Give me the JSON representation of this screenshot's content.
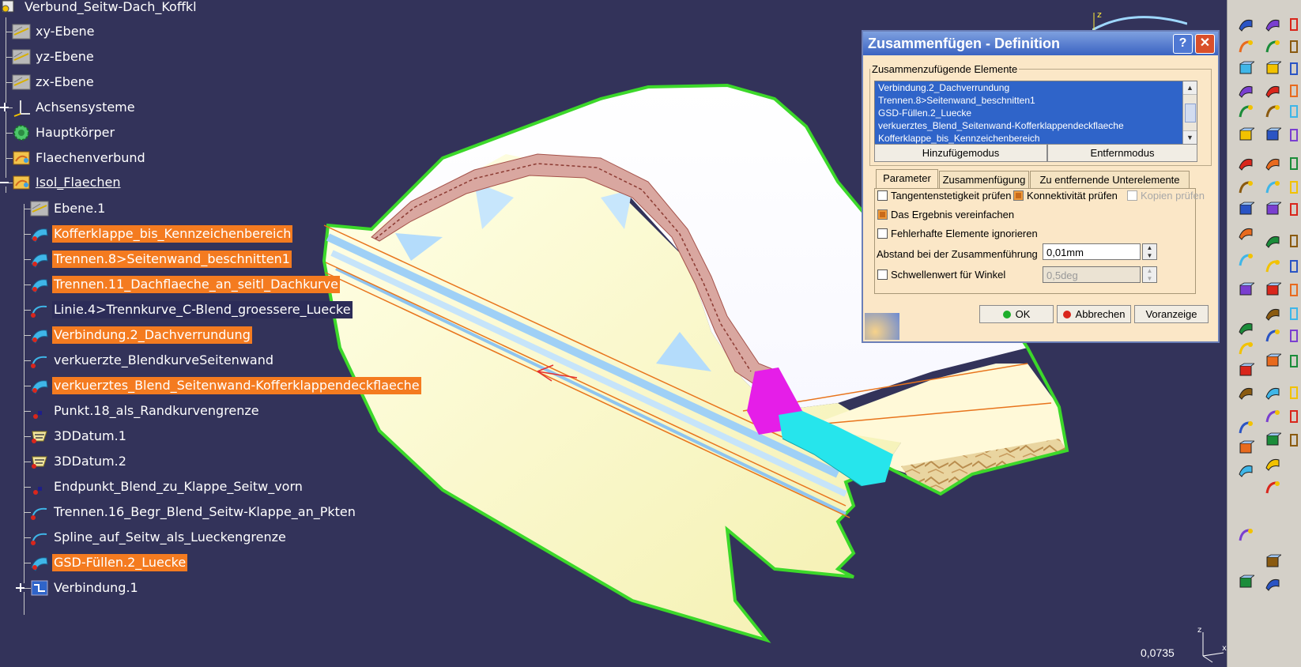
{
  "tree": {
    "root": "Verbund_Seitw-Dach_Koffkl",
    "items": [
      {
        "label": "xy-Ebene",
        "icon": "plane-icon",
        "state": "normal"
      },
      {
        "label": "yz-Ebene",
        "icon": "plane-icon",
        "state": "normal"
      },
      {
        "label": "zx-Ebene",
        "icon": "plane-icon",
        "state": "normal"
      },
      {
        "label": "Achsensysteme",
        "icon": "axis-system-icon",
        "state": "normal"
      },
      {
        "label": "Hauptkörper",
        "icon": "body-gear-icon",
        "state": "normal"
      },
      {
        "label": "Flaechenverbund",
        "icon": "geometrical-set-icon",
        "state": "normal"
      },
      {
        "label": "Isol_Flaechen",
        "icon": "geometrical-set-icon",
        "state": "underlined"
      },
      {
        "label": "Ebene.1",
        "icon": "plane-icon",
        "state": "normal"
      },
      {
        "label": "Kofferklappe_bis_Kennzeichenbereich",
        "icon": "surface-icon",
        "state": "selected"
      },
      {
        "label": "Trennen.8>Seitenwand_beschnitten1",
        "icon": "surface-icon",
        "state": "selected"
      },
      {
        "label": "Trennen.11_Dachflaeche_an_seitl_Dachkurve",
        "icon": "surface-icon",
        "state": "selected"
      },
      {
        "label": "Linie.4>Trennkurve_C-Blend_groessere_Luecke",
        "icon": "curve-icon",
        "state": "highlighted"
      },
      {
        "label": "Verbindung.2_Dachverrundung",
        "icon": "surface-icon",
        "state": "selected"
      },
      {
        "label": "verkuerzte_BlendkurveSeitenwand",
        "icon": "curve-icon",
        "state": "normal"
      },
      {
        "label": "verkuerztes_Blend_Seitenwand-Kofferklappendeckflaeche",
        "icon": "surface-icon",
        "state": "selected"
      },
      {
        "label": "Punkt.18_als_Randkurvengrenze",
        "icon": "point-icon",
        "state": "normal"
      },
      {
        "label": "3DDatum.1",
        "icon": "datum-icon",
        "state": "normal"
      },
      {
        "label": "3DDatum.2",
        "icon": "datum-icon",
        "state": "normal"
      },
      {
        "label": "Endpunkt_Blend_zu_Klappe_Seitw_vorn",
        "icon": "point-icon",
        "state": "normal"
      },
      {
        "label": "Trennen.16_Begr_Blend_Seitw-Klappe_an_Pkten",
        "icon": "curve-icon",
        "state": "normal"
      },
      {
        "label": "Spline_auf_Seitw_als_Lueckengrenze",
        "icon": "curve-icon",
        "state": "normal"
      },
      {
        "label": "GSD-Füllen.2_Luecke",
        "icon": "surface-icon",
        "state": "selected"
      },
      {
        "label": "Verbindung.1",
        "icon": "join-icon",
        "state": "normal"
      }
    ]
  },
  "dialog": {
    "title": "Zusammenfügen - Definition",
    "help": "?",
    "close": "✕",
    "group_label": "Zusammenzufügende Elemente",
    "elements": [
      "Verbindung.2_Dachverrundung",
      "Trennen.8>Seitenwand_beschnitten1",
      "GSD-Füllen.2_Luecke",
      "verkuerztes_Blend_Seitenwand-Kofferklappendeckflaeche",
      "Kofferklappe_bis_Kennzeichenbereich"
    ],
    "add_mode": "Hinzufügemodus",
    "remove_mode": "Entfernmodus",
    "tabs": [
      "Parameter",
      "Zusammenfügung",
      "Zu entfernende Unterelemente"
    ],
    "active_tab": "Parameter",
    "check_tangent": "Tangentenstetigkeit prüfen",
    "check_connectivity": "Konnektivität prüfen",
    "check_copies": "Kopien prüfen",
    "simplify": "Das Ergebnis vereinfachen",
    "ignore_faulty": "Fehlerhafte Elemente ignorieren",
    "distance_label": "Abstand bei der Zusammenführung",
    "distance_value": "0,01mm",
    "angle_label": "Schwellenwert für Winkel",
    "angle_value": "0,5deg",
    "ok": "OK",
    "cancel": "Abbrechen",
    "preview": "Voranzeige"
  },
  "viewport": {
    "zoom_value": "0,0735",
    "compass_axis": "z",
    "mini_axis_z": "z",
    "mini_axis_x": "x"
  },
  "colors": {
    "background": "#33335a",
    "selection": "#f47b20",
    "dialog_bg": "#fbe7c7",
    "list_selection": "#2f64c9"
  }
}
